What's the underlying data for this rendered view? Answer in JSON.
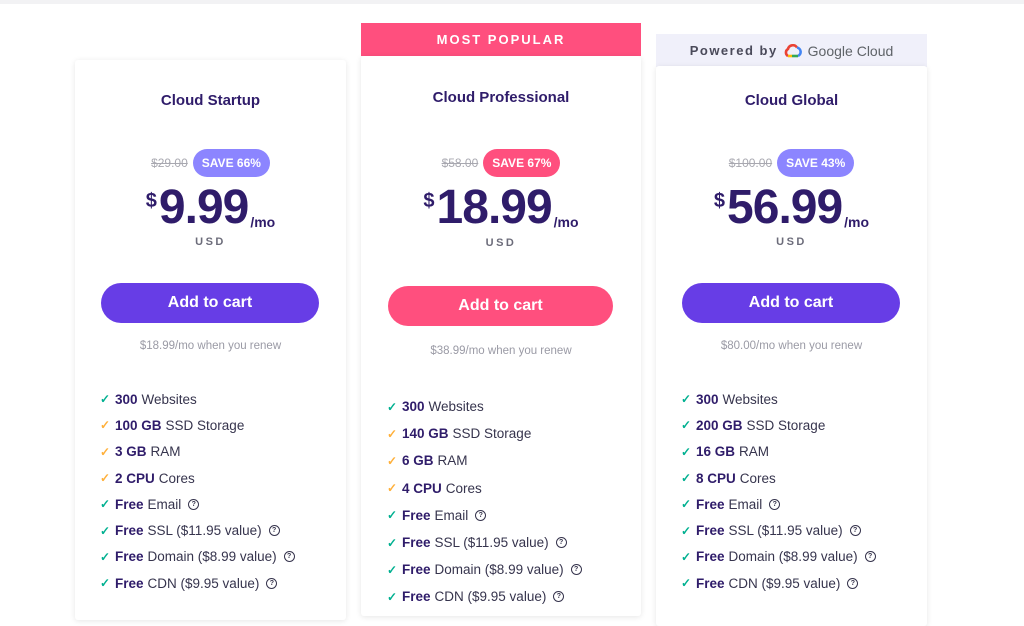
{
  "colors": {
    "primary_purple": "#673de6",
    "accent_pink": "#ff4f7e",
    "badge_purple": "#8c85ff",
    "heading": "#2f1c6a",
    "check_green": "#00b090",
    "check_orange": "#ffb03a"
  },
  "plans": [
    {
      "name": "Cloud Startup",
      "old_price": "$29.00",
      "save_badge": "SAVE 66%",
      "currency_symbol": "$",
      "price": "9.99",
      "period": "/mo",
      "currency": "USD",
      "cta": "Add to cart",
      "renew_note": "$18.99/mo when you renew",
      "features": [
        {
          "bold": "300",
          "text": "Websites",
          "check": "green",
          "help": false
        },
        {
          "bold": "100 GB",
          "text": "SSD Storage",
          "check": "orange",
          "help": false
        },
        {
          "bold": "3 GB",
          "text": "RAM",
          "check": "orange",
          "help": false
        },
        {
          "bold": "2 CPU",
          "text": "Cores",
          "check": "orange",
          "help": false
        },
        {
          "bold": "Free",
          "text": "Email",
          "check": "green",
          "help": true
        },
        {
          "bold": "Free",
          "text": "SSL ($11.95 value)",
          "check": "green",
          "help": true
        },
        {
          "bold": "Free",
          "text": "Domain ($8.99 value)",
          "check": "green",
          "help": true
        },
        {
          "bold": "Free",
          "text": "CDN ($9.95 value)",
          "check": "green",
          "help": true
        }
      ]
    },
    {
      "ribbon": "MOST POPULAR",
      "name": "Cloud Professional",
      "old_price": "$58.00",
      "save_badge": "SAVE 67%",
      "currency_symbol": "$",
      "price": "18.99",
      "period": "/mo",
      "currency": "USD",
      "cta": "Add to cart",
      "renew_note": "$38.99/mo when you renew",
      "features": [
        {
          "bold": "300",
          "text": "Websites",
          "check": "green",
          "help": false
        },
        {
          "bold": "140 GB",
          "text": "SSD Storage",
          "check": "orange",
          "help": false
        },
        {
          "bold": "6 GB",
          "text": "RAM",
          "check": "orange",
          "help": false
        },
        {
          "bold": "4 CPU",
          "text": "Cores",
          "check": "orange",
          "help": false
        },
        {
          "bold": "Free",
          "text": "Email",
          "check": "green",
          "help": true
        },
        {
          "bold": "Free",
          "text": "SSL ($11.95 value)",
          "check": "green",
          "help": true
        },
        {
          "bold": "Free",
          "text": "Domain ($8.99 value)",
          "check": "green",
          "help": true
        },
        {
          "bold": "Free",
          "text": "CDN ($9.95 value)",
          "check": "green",
          "help": true
        }
      ]
    },
    {
      "powered_by": "Powered by",
      "powered_brand": "Google Cloud",
      "name": "Cloud Global",
      "old_price": "$100.00",
      "save_badge": "SAVE 43%",
      "currency_symbol": "$",
      "price": "56.99",
      "period": "/mo",
      "currency": "USD",
      "cta": "Add to cart",
      "renew_note": "$80.00/mo when you renew",
      "features": [
        {
          "bold": "300",
          "text": "Websites",
          "check": "green",
          "help": false
        },
        {
          "bold": "200 GB",
          "text": "SSD Storage",
          "check": "green",
          "help": false
        },
        {
          "bold": "16 GB",
          "text": "RAM",
          "check": "green",
          "help": false
        },
        {
          "bold": "8 CPU",
          "text": "Cores",
          "check": "green",
          "help": false
        },
        {
          "bold": "Free",
          "text": "Email",
          "check": "green",
          "help": true
        },
        {
          "bold": "Free",
          "text": "SSL ($11.95 value)",
          "check": "green",
          "help": true
        },
        {
          "bold": "Free",
          "text": "Domain ($8.99 value)",
          "check": "green",
          "help": true
        },
        {
          "bold": "Free",
          "text": "CDN ($9.95 value)",
          "check": "green",
          "help": true
        }
      ]
    }
  ],
  "icons": {
    "check": "✓",
    "help": "?"
  }
}
